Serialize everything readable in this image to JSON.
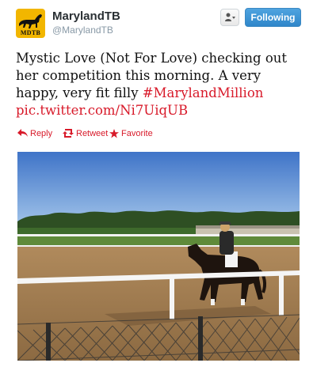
{
  "header": {
    "avatar_text": "MDTB",
    "display_name": "MarylandTB",
    "handle": "@MarylandTB",
    "follow_label": "Following"
  },
  "tweet": {
    "text_plain": "Mystic Love (Not For Love) checking out her competition this morning. A very happy, very fit filly ",
    "hashtag": "#MarylandMillion",
    "pic_link": "pic.twitter.com/Ni7UiqUB"
  },
  "actions": {
    "reply_label": "Reply",
    "retweet_label": "Retweet",
    "favorite_label": "Favorite"
  },
  "icons": {
    "avatar": "horse-logo-icon",
    "user_menu": "user-dropdown-icon",
    "reply": "reply-icon",
    "retweet": "retweet-icon",
    "favorite": "star-icon"
  },
  "colors": {
    "link": "#d81a2a",
    "follow_button": "#2f86ca",
    "avatar_bg": "#f2b600"
  }
}
